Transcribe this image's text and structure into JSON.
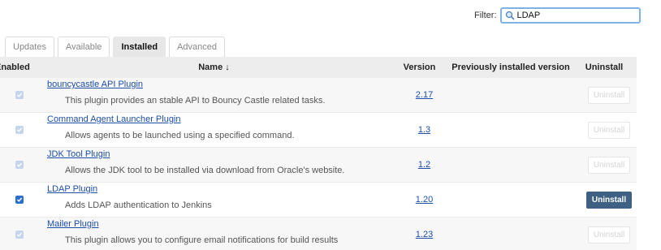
{
  "filter": {
    "label": "Filter:",
    "value": "LDAP"
  },
  "tabs": [
    {
      "label": "Updates",
      "active": false
    },
    {
      "label": "Available",
      "active": false
    },
    {
      "label": "Installed",
      "active": true
    },
    {
      "label": "Advanced",
      "active": false
    }
  ],
  "table": {
    "headers": {
      "enabled": "Enabled",
      "name": "Name ↓",
      "version": "Version",
      "previous": "Previously installed version",
      "uninstall": "Uninstall"
    },
    "rows": [
      {
        "name": "bouncycastle API Plugin",
        "description": "This plugin provides an stable API to Bouncy Castle related tasks.",
        "version": "2.17",
        "uninstall_label": "Uninstall",
        "uninstall_enabled": false,
        "checked": true,
        "checkbox_active": false
      },
      {
        "name": "Command Agent Launcher Plugin",
        "description": "Allows agents to be launched using a specified command.",
        "version": "1.3",
        "uninstall_label": "Uninstall",
        "uninstall_enabled": false,
        "checked": true,
        "checkbox_active": false
      },
      {
        "name": "JDK Tool Plugin",
        "description": "Allows the JDK tool to be installed via download from Oracle's website.",
        "version": "1.2",
        "uninstall_label": "Uninstall",
        "uninstall_enabled": false,
        "checked": true,
        "checkbox_active": false
      },
      {
        "name": "LDAP Plugin",
        "description": "Adds LDAP authentication to Jenkins",
        "version": "1.20",
        "uninstall_label": "Uninstall",
        "uninstall_enabled": true,
        "checked": true,
        "checkbox_active": true
      },
      {
        "name": "Mailer Plugin",
        "description": "This plugin allows you to configure email notifications for build results",
        "version": "1.23",
        "uninstall_label": "Uninstall",
        "uninstall_enabled": false,
        "checked": true,
        "checkbox_active": false
      }
    ]
  },
  "icons": {
    "search": "search-icon"
  }
}
